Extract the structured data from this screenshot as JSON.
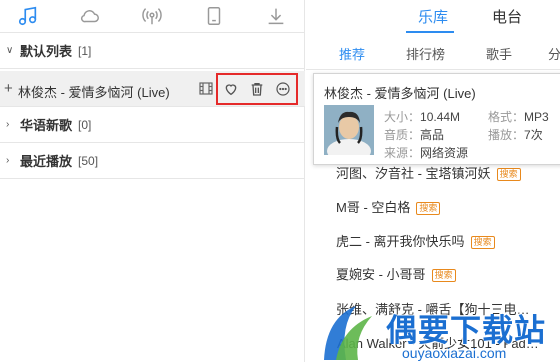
{
  "left_panel": {
    "toolbar_icons": [
      "music-note-icon",
      "cloud-icon",
      "radio-icon",
      "device-icon",
      "download-icon"
    ],
    "groups": [
      {
        "name": "默认列表",
        "count": "[1]",
        "expanded": true
      },
      {
        "name": "华语新歌",
        "count": "[0]",
        "expanded": false
      },
      {
        "name": "最近播放",
        "count": "[50]",
        "expanded": false
      }
    ],
    "song": {
      "title": "林俊杰 - 爱情多恼河 (Live)"
    },
    "actions": [
      "mv-icon",
      "heart-icon",
      "delete-icon",
      "more-icon"
    ]
  },
  "right_panel": {
    "tabs": [
      {
        "label": "乐库",
        "active": true
      },
      {
        "label": "电台",
        "active": false
      }
    ],
    "subtabs": [
      {
        "label": "推荐",
        "active": true
      },
      {
        "label": "排行榜",
        "active": false
      },
      {
        "label": "歌手",
        "active": false
      },
      {
        "label": "分",
        "active": false
      }
    ],
    "songs": [
      {
        "title": "河图、汐音社 - 宝塔镇河妖",
        "tag": "搜索"
      },
      {
        "title": "M哥 - 空白格",
        "tag": "搜索"
      },
      {
        "title": "虎二 - 离开我你快乐吗",
        "tag": "搜索"
      },
      {
        "title": "夏婉安 - 小哥哥",
        "tag": "搜索"
      },
      {
        "title": "张维、满舒克 - 嚼舌【狗十三电…",
        "tag": ""
      },
      {
        "title": "Alan Walker - 火箭少女101 - Fad…",
        "tag": ""
      }
    ]
  },
  "popup": {
    "title": "林俊杰 - 爱情多恼河 (Live)",
    "size_label": "大小：",
    "size_value": "10.44M",
    "format_label": "格式：",
    "format_value": "MP3",
    "quality_label": "音质：",
    "quality_value": "高品",
    "plays_label": "播放：",
    "plays_value": "7次",
    "source_label": "来源：",
    "source_value": "网络资源"
  },
  "watermark": {
    "text": "偶要下载站",
    "url": "ouyaoxiazai.com"
  },
  "colors": {
    "accent": "#2d8cf0",
    "highlight_box": "#e52a2a",
    "tag": "#e8891d"
  }
}
